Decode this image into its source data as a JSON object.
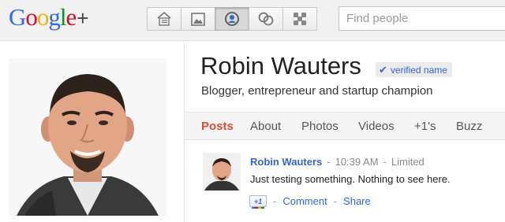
{
  "header": {
    "logo": {
      "letters": [
        "G",
        "o",
        "o",
        "g",
        "l",
        "e"
      ],
      "colors": [
        "#3369e8",
        "#d50f25",
        "#eeb211",
        "#3369e8",
        "#009925",
        "#d50f25"
      ],
      "plus": "+"
    },
    "nav": [
      {
        "name": "home-button",
        "icon": "home-stream-icon"
      },
      {
        "name": "photos-button",
        "icon": "photos-icon"
      },
      {
        "name": "profile-button",
        "icon": "profile-icon",
        "active": true
      },
      {
        "name": "circles-button",
        "icon": "circles-icon"
      },
      {
        "name": "games-button",
        "icon": "games-icon"
      }
    ],
    "search": {
      "placeholder": "Find people",
      "value": ""
    }
  },
  "profile": {
    "name": "Robin Wauters",
    "verified_label": "verified name",
    "tagline": "Blogger, entrepreneur and startup champion"
  },
  "tabs": [
    {
      "label": "Posts",
      "active": true
    },
    {
      "label": "About"
    },
    {
      "label": "Photos"
    },
    {
      "label": "Videos"
    },
    {
      "label": "+1's"
    },
    {
      "label": "Buzz"
    }
  ],
  "post": {
    "author": "Robin Wauters",
    "time": "10:39 AM",
    "visibility": "Limited",
    "separator": "-",
    "body": "Just testing something. Nothing to see here.",
    "plusone_label": "+1",
    "comment_label": "Comment",
    "share_label": "Share"
  },
  "colors": {
    "accent": "#3366cc",
    "active_tab": "#dd4b39"
  }
}
